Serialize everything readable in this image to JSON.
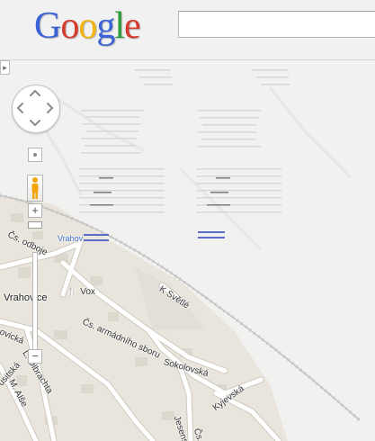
{
  "header": {
    "logo_text": "Google",
    "search": {
      "value": "",
      "placeholder": ""
    }
  },
  "map": {
    "town_label": "Vrahovice",
    "poi_label": "Vox",
    "streets": {
      "k_svetle": "K Světlé",
      "cs_armadniho_sboru": "Čs. armádního sboru",
      "sokolovska": "Sokolovská",
      "kyjevska": "Kyjevská",
      "jesenska": "Jesenská",
      "cs_odboje": "Čs. odboje",
      "l_oubrachta": "L. Olbrachta",
      "m_alse": "M. Alše",
      "cs_partial": "Čs. a",
      "palackeho_partial": "ovická",
      "usitska_partial": "usitská"
    },
    "tile_label": "Vrahov"
  },
  "controls": {
    "zoom_in": "+",
    "zoom_out": "−",
    "collapse": "▸",
    "zoom_level_fraction": 0.02
  },
  "colors": {
    "town_area": "#e9e5dc",
    "road": "#ffffff",
    "road_edge": "#cfcac0",
    "railway": "#b9b9b9",
    "empty_tile": "#f1f1ef"
  }
}
